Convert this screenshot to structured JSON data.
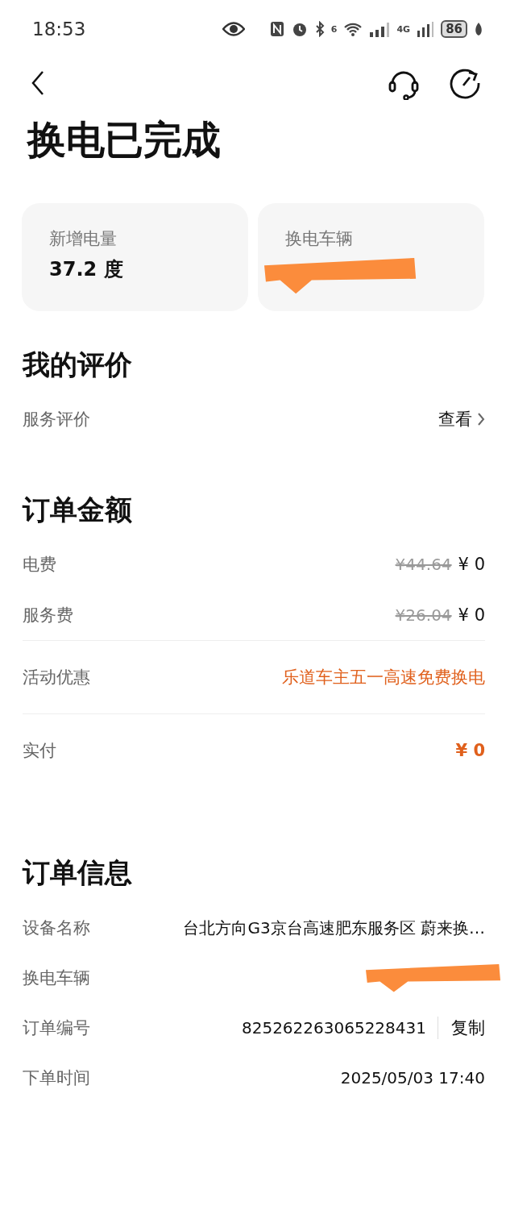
{
  "status_bar": {
    "time": "18:53",
    "wifi_band": "6",
    "network": "4G",
    "battery": "86"
  },
  "title": "换电已完成",
  "summary_cards": [
    {
      "label": "新增电量",
      "value": "37.2 度",
      "redacted": false
    },
    {
      "label": "换电车辆",
      "redacted": true
    }
  ],
  "review": {
    "heading": "我的评价",
    "label": "服务评价",
    "action": "查看"
  },
  "amount": {
    "heading": "订单金额",
    "groups": [
      [
        {
          "kind": "price",
          "label": "电费",
          "original": "¥44.64",
          "value": "¥ 0"
        },
        {
          "kind": "price",
          "label": "服务费",
          "original": "¥26.04",
          "value": "¥ 0"
        }
      ],
      [
        {
          "kind": "promo",
          "label": "活动优惠",
          "value": "乐道车主五一高速免费换电"
        }
      ],
      [
        {
          "kind": "total",
          "label": "实付",
          "value": "¥ 0"
        }
      ]
    ]
  },
  "info": {
    "heading": "订单信息",
    "rows": [
      {
        "kind": "text",
        "label": "设备名称",
        "value": "台北方向G3京台高速肥东服务区 蔚来换…"
      },
      {
        "kind": "redacted",
        "label": "换电车辆"
      },
      {
        "kind": "copy",
        "label": "订单编号",
        "value": "825262263065228431",
        "action": "复制"
      },
      {
        "kind": "text",
        "label": "下单时间",
        "value": "2025/05/03 17:40"
      }
    ]
  }
}
